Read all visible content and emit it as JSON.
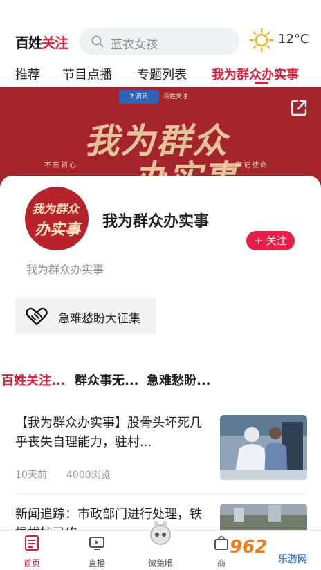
{
  "header": {
    "logo": {
      "part1": "百姓",
      "part2": "关注"
    },
    "search_placeholder": "蓝衣女孩",
    "weather": {
      "temp": "12°C"
    }
  },
  "tabs": [
    {
      "label": "推荐"
    },
    {
      "label": "节目点播"
    },
    {
      "label": "专题列表"
    },
    {
      "label": "我为群众办实事",
      "active": true
    }
  ],
  "banner": {
    "headline_line1": "我为群众",
    "headline_line2": "办实事",
    "slogan_left": "不忘初心",
    "slogan_right": "牢记使命",
    "logo_left": "2 资讯",
    "logo_right": "百姓关注"
  },
  "channel": {
    "avatar_line1": "我为群众",
    "avatar_line2": "办实事",
    "title": "我为群众办实事",
    "follow_label": "+ 关注",
    "description": "我为群众办实事",
    "tag_label": "急难愁盼大征集"
  },
  "subtabs": [
    {
      "label": "百姓关注...",
      "active": true
    },
    {
      "label": "群众事无..."
    },
    {
      "label": "急难愁盼..."
    }
  ],
  "news": [
    {
      "title": "【我为群众办实事】股骨头坏死几乎丧失自理能力，驻村...",
      "time": "10天前",
      "views": "4000浏览"
    },
    {
      "title": "新闻追踪：市政部门进行处理，铁棍拔掉已修...",
      "time": "",
      "views": ""
    }
  ],
  "bottom_nav": [
    {
      "label": "首页",
      "icon": "home-icon",
      "active": true
    },
    {
      "label": "直播",
      "icon": "tv-icon"
    },
    {
      "label": "微兔眼",
      "icon": "rabbit-icon"
    },
    {
      "label": "商",
      "icon": "shop-icon"
    }
  ],
  "watermark": {
    "brand": "962",
    "sub": "乐游网"
  },
  "colors": {
    "accent": "#d81f3b",
    "banner": "#a5232b",
    "follow": "#e51f45"
  }
}
